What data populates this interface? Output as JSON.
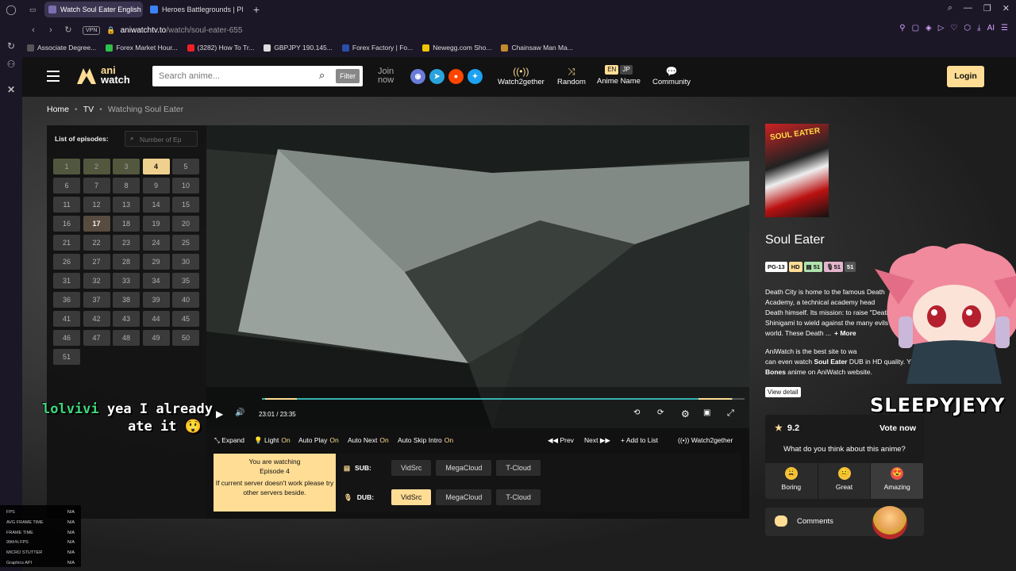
{
  "browser": {
    "tabs": [
      {
        "title": "Watch Soul Eater English",
        "active": true,
        "favicon_color": "#7a6fb0"
      },
      {
        "title": "Heroes Battlegrounds | Pl",
        "active": false,
        "favicon_color": "#3b82f6"
      }
    ],
    "url_host": "aniwatchtv.to",
    "url_path": "/watch/soul-eater-655",
    "vpn_label": "VPN",
    "bookmarks": [
      {
        "label": "Associate Degree...",
        "color": "#555"
      },
      {
        "label": "Forex Market Hour...",
        "color": "#2fbf4a"
      },
      {
        "label": "(3282) How To Tr...",
        "color": "#e22"
      },
      {
        "label": "GBPJPY 190.145...",
        "color": "#ddd"
      },
      {
        "label": "Forex Factory | Fo...",
        "color": "#2b4fa8"
      },
      {
        "label": "Newegg.com Sho...",
        "color": "#f2c300"
      },
      {
        "label": "Chainsaw Man Ma...",
        "color": "#c38a2e"
      }
    ]
  },
  "site": {
    "logo_top": "ani",
    "logo_bottom": "watch",
    "search_placeholder": "Search anime...",
    "filter_label": "Filter",
    "join_line1": "Join",
    "join_line2": "now",
    "socials": [
      {
        "name": "discord",
        "color": "#6b7bd8",
        "glyph": "◉"
      },
      {
        "name": "telegram",
        "color": "#2aa3dd",
        "glyph": "➤"
      },
      {
        "name": "reddit",
        "color": "#ff4500",
        "glyph": "●"
      },
      {
        "name": "twitter",
        "color": "#1da1f2",
        "glyph": "✦"
      }
    ],
    "nav": {
      "watch2gether": "Watch2gether",
      "random": "Random",
      "anime_name": "Anime Name",
      "community": "Community",
      "lang_en": "EN",
      "lang_jp": "JP"
    },
    "login_label": "Login"
  },
  "breadcrumb": {
    "home": "Home",
    "tv": "TV",
    "current": "Watching Soul Eater"
  },
  "episodes": {
    "title": "List of episodes:",
    "search_placeholder": "Number of Ep",
    "current": 4,
    "watched": [
      1,
      2,
      3
    ],
    "visited": [
      17
    ],
    "total": 51
  },
  "player": {
    "current_time": "23:01",
    "duration": "23:35",
    "progress_fraction": 0.976
  },
  "chat_overlay": {
    "user": "lolvivi",
    "line1": "yea I already",
    "line2": "ate it 😲"
  },
  "options": {
    "expand": "Expand",
    "light": "Light",
    "light_state": "On",
    "auto_play": "Auto Play",
    "auto_play_state": "On",
    "auto_next": "Auto Next",
    "auto_next_state": "On",
    "auto_skip": "Auto Skip Intro",
    "auto_skip_state": "On",
    "prev": "Prev",
    "next": "Next",
    "add_list": "Add to List",
    "watch2gether": "Watch2gether"
  },
  "servers": {
    "watching_line1": "You are watching",
    "watching_line2": "Episode 4",
    "watching_note": "If current server doesn't work please try other servers beside.",
    "sub_label": "SUB:",
    "dub_label": "DUB:",
    "sub": [
      "VidSrc",
      "MegaCloud",
      "T-Cloud"
    ],
    "dub": [
      "VidSrc",
      "MegaCloud",
      "T-Cloud"
    ],
    "dub_selected": "VidSrc"
  },
  "anime": {
    "poster_text": "SOUL EATER",
    "title": "Soul Eater",
    "tags": [
      {
        "text": "PG-13",
        "bg": "#fff",
        "fg": "#111"
      },
      {
        "text": "HD",
        "bg": "#ffdd95",
        "fg": "#111"
      },
      {
        "text": "51",
        "bg": "#b0e3af",
        "fg": "#111",
        "icon": "cc-icon"
      },
      {
        "text": "51",
        "bg": "#e3b5cd",
        "fg": "#111",
        "icon": "mic-icon"
      },
      {
        "text": "51",
        "bg": "#555",
        "fg": "#fff"
      }
    ],
    "desc_lines": [
      "Death City is home to the famous Death",
      "Academy, a technical academy head",
      "Death himself. Its mission: to raise \"Death",
      "Shinigami to wield against the many evils",
      "world. These Death ..."
    ],
    "more": "+ More",
    "desc2_prefix": "AniWatch is the best site to wa",
    "desc2_mid": "can even watch ",
    "desc2_bold1": "Soul Eater",
    "desc2_after": " DUB in HD quality. You can also find",
    "desc2_bold2": "Bones",
    "desc2_end": " anime on AniWatch website.",
    "view_detail": "View detail"
  },
  "rating": {
    "score": "9.2",
    "vote_label": "Vote now",
    "question": "What do you think about this anime?",
    "options": [
      {
        "label": "Boring",
        "glyph": "😩"
      },
      {
        "label": "Great",
        "glyph": "😐"
      },
      {
        "label": "Amazing",
        "glyph": "😍"
      }
    ]
  },
  "comments_label": "Comments",
  "streamer_name": "SLEEPYJEYY",
  "fps_overlay": [
    {
      "label": "FPS",
      "value": "N/A"
    },
    {
      "label": "AVG FRAME TIME",
      "value": "N/A"
    },
    {
      "label": "FRAME TIME",
      "value": "N/A"
    },
    {
      "label": "99th% FPS",
      "value": "N/A"
    },
    {
      "label": "MICRO STUTTER",
      "value": "N/A"
    },
    {
      "label": "Graphics API",
      "value": "N/A"
    }
  ]
}
